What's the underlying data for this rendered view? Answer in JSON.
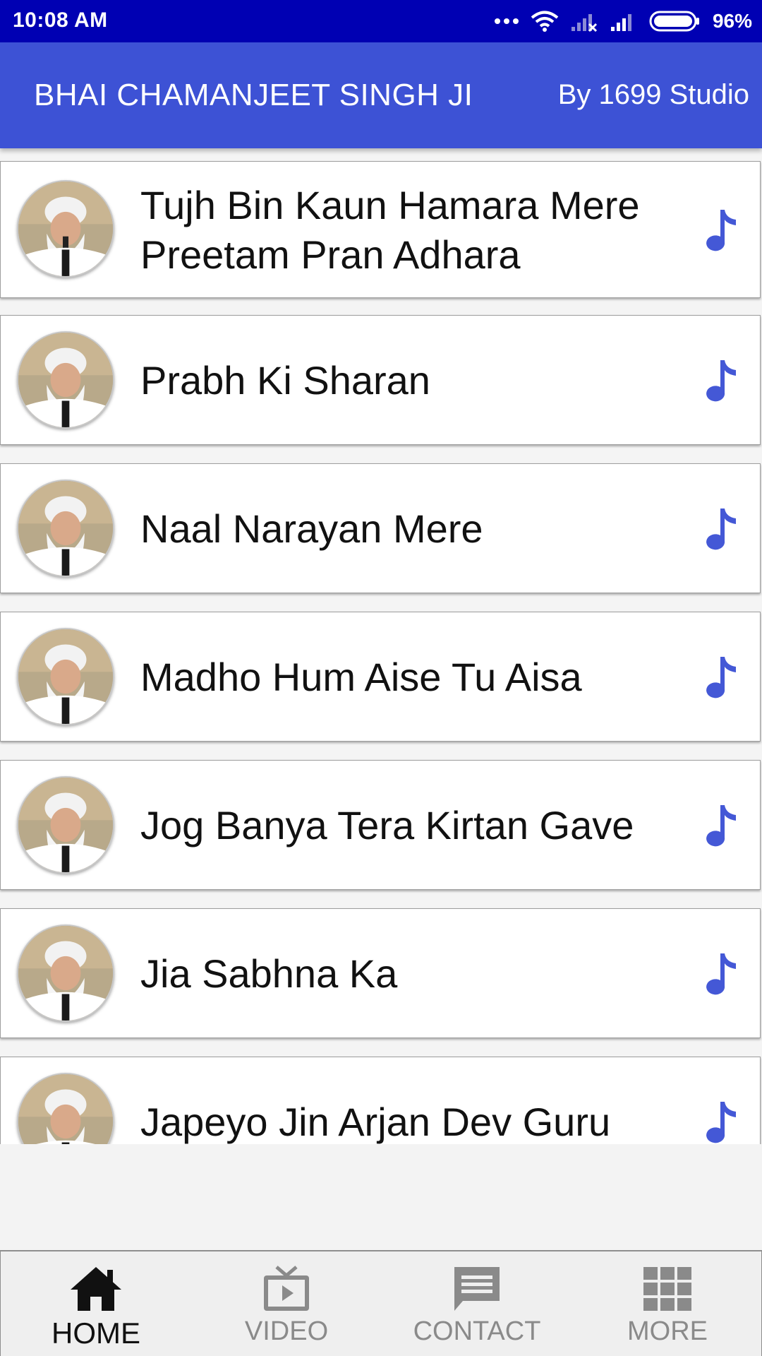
{
  "status_bar": {
    "time": "10:08 AM",
    "battery": "96%",
    "icons": [
      "more-dots-icon",
      "wifi-icon",
      "signal-no-sim-icon",
      "signal-icon",
      "battery-icon"
    ]
  },
  "header": {
    "title": "BHAI CHAMANJEET SINGH JI",
    "subtitle": "By 1699 Studio",
    "color": "#3d52d5"
  },
  "tracks": [
    {
      "title": "Tujh Bin Kaun Hamara Mere Preetam Pran Adhara",
      "icon": "music-note-icon"
    },
    {
      "title": "Prabh Ki Sharan",
      "icon": "music-note-icon"
    },
    {
      "title": "Naal Narayan Mere",
      "icon": "music-note-icon"
    },
    {
      "title": "Madho Hum Aise Tu Aisa",
      "icon": "music-note-icon"
    },
    {
      "title": "Jog Banya Tera Kirtan Gave",
      "icon": "music-note-icon"
    },
    {
      "title": "Jia Sabhna Ka",
      "icon": "music-note-icon"
    },
    {
      "title": "Japeyo Jin Arjan Dev Guru",
      "icon": "music-note-icon"
    }
  ],
  "bottom_nav": {
    "items": [
      {
        "label": "HOME",
        "icon": "home-icon",
        "active": true
      },
      {
        "label": "VIDEO",
        "icon": "video-icon",
        "active": false
      },
      {
        "label": "CONTACT",
        "icon": "chat-icon",
        "active": false
      },
      {
        "label": "MORE",
        "icon": "grid-icon",
        "active": false
      }
    ]
  },
  "colors": {
    "status_bar": "#0000b3",
    "accent": "#3d52d5",
    "note_icon": "#4458d6"
  }
}
